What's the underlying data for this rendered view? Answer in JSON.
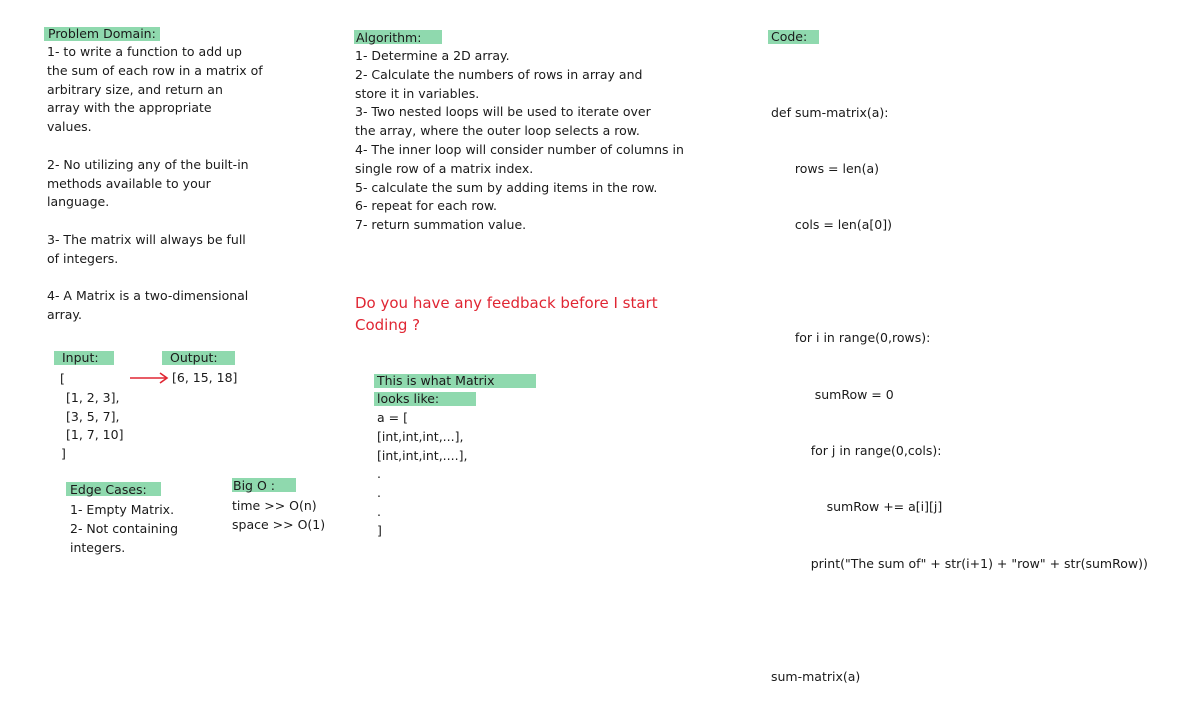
{
  "problem": {
    "heading": "Problem Domain:",
    "lines": [
      "1- to write a function to add up",
      "the sum of each row in a matrix of",
      "arbitrary size, and return an",
      "array with the appropriate",
      "values.",
      "",
      "2- No utilizing any of the built-in",
      "methods available to your",
      "language.",
      "",
      "3- The matrix will always be full",
      "of integers.",
      "",
      "4- A Matrix is a two-dimensional",
      "array."
    ]
  },
  "io": {
    "input_label": "Input:",
    "output_label": "Output:",
    "output_value": "[6, 15, 18]",
    "input_lines": [
      "[",
      "[1, 2, 3],",
      "[3, 5, 7],",
      "[1, 7, 10]",
      "]"
    ]
  },
  "edge": {
    "heading": "Edge Cases:",
    "lines": [
      "1- Empty Matrix.",
      "2- Not containing",
      "integers."
    ]
  },
  "bigo": {
    "heading": "Big O :",
    "lines": [
      "time >> O(n)",
      "space >> O(1)"
    ]
  },
  "algorithm": {
    "heading": "Algorithm:",
    "lines": [
      "1- Determine a 2D array.",
      "2- Calculate the numbers of rows in array and",
      "store it in variables.",
      "3- Two nested loops will be used to iterate over",
      "the array, where the outer loop selects a row.",
      "4- The inner loop will consider number of columns in",
      "single row of a matrix index.",
      "5- calculate the sum by adding items in the row.",
      "6- repeat for each row.",
      "7- return summation value."
    ]
  },
  "feedback": {
    "lines": [
      "Do you have any feedback before I start",
      "Coding ?"
    ]
  },
  "matrix": {
    "heading_line1": "This is what Matrix",
    "heading_line2": "looks like:",
    "lines": [
      "a = [",
      "[int,int,int,...],",
      "[int,int,int,....],",
      ".",
      ".",
      ".",
      "]"
    ]
  },
  "code": {
    "heading": "Code:",
    "lines": [
      "def sum-matrix(a):",
      "      rows = len(a)",
      "      cols = len(a[0])",
      "",
      "      for i in range(0,rows):",
      "           sumRow = 0",
      "          for j in range(0,cols):",
      "              sumRow += a[i][j]",
      "          print(\"The sum of\" + str(i+1) + \"row\" + str(sumRow))",
      "",
      "sum-matrix(a)"
    ]
  },
  "colors": {
    "highlight": "#8fd9ae",
    "feedback_text": "#e02633",
    "arrow": "#e02633"
  }
}
